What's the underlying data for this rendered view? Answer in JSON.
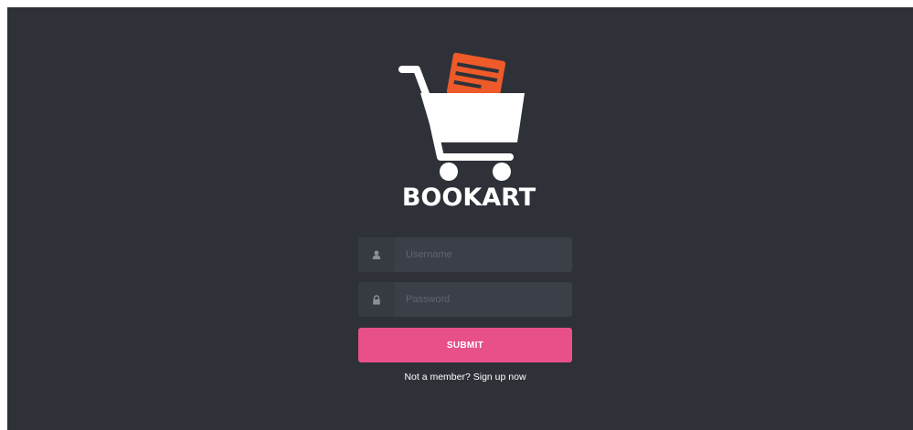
{
  "brand": {
    "name": "BOOKART",
    "logo_icon": "shopping-cart-with-books-icon",
    "logo_color_cart": "#ffffff",
    "logo_color_books": "#ee5a2a"
  },
  "login": {
    "username": {
      "icon": "user-icon",
      "placeholder": "Username",
      "value": ""
    },
    "password": {
      "icon": "lock-icon",
      "placeholder": "Password",
      "value": ""
    },
    "submit_label": "SUBMIT",
    "signup_prompt": "Not a member?",
    "signup_link": "Sign up now"
  },
  "colors": {
    "background": "#2e3238",
    "input_background": "#3b4048",
    "icon_background": "#363b42",
    "submit_button": "#e8508a"
  }
}
